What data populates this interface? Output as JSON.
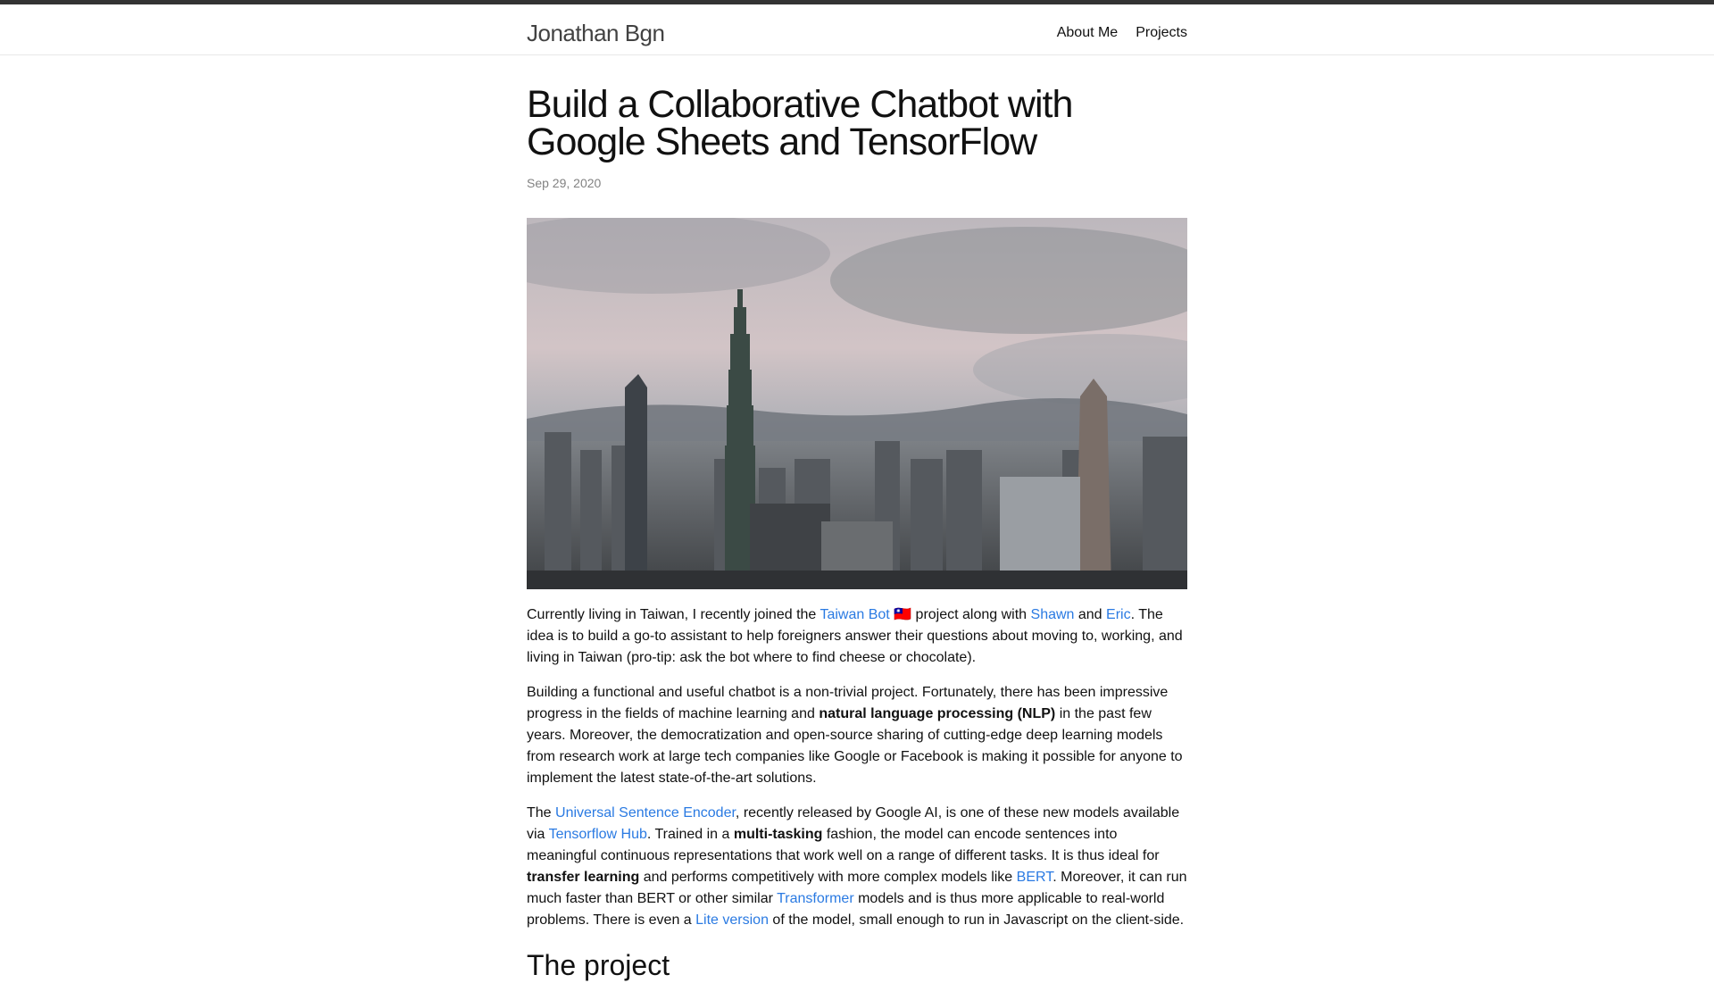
{
  "site": {
    "title": "Jonathan Bgn",
    "nav": [
      "About Me",
      "Projects"
    ]
  },
  "post": {
    "title": "Build a Collaborative Chatbot with Google Sheets and TensorFlow",
    "date": "Sep 29, 2020",
    "hero_alt": "Taipei skyline with Taipei 101",
    "p1": {
      "t1": "Currently living in Taiwan, I recently joined the ",
      "link1": "Taiwan Bot 🇹🇼",
      "t2": " project along with ",
      "link2": "Shawn",
      "t3": " and ",
      "link3": "Eric",
      "t4": ". The idea is to build a go-to assistant to help foreigners answer their questions about moving to, working, and living in Taiwan (pro-tip: ask the bot where to find cheese or chocolate)."
    },
    "p2": {
      "t1": "Building a functional and useful chatbot is a non-trivial project. Fortunately, there has been impressive progress in the fields of machine learning and ",
      "b1": "natural language processing (NLP)",
      "t2": " in the past few years. Moreover, the democratization and open-source sharing of cutting-edge deep learning models from research work at large tech companies like Google or Facebook is making it possible for anyone to implement the latest state-of-the-art solutions."
    },
    "p3": {
      "t1": "The ",
      "link1": "Universal Sentence Encoder",
      "t2": ", recently released by Google AI, is one of these new models available via ",
      "link2": "Tensorflow Hub",
      "t3": ". Trained in a ",
      "b1": "multi-tasking",
      "t4": " fashion, the model can encode sentences into meaningful continuous representations that work well on a range of different tasks. It is thus ideal for ",
      "b2": "transfer learning",
      "t5": " and performs competitively with more complex models like ",
      "link3": "BERT",
      "t6": ". Moreover, it can run much faster than BERT or other similar ",
      "link4": "Transformer",
      "t7": " models and is thus more applicable to real-world problems. There is even a ",
      "link5": "Lite version",
      "t8": " of the model, small enough to run in Javascript on the client-side."
    },
    "section_heading": "The project"
  },
  "colors": {
    "link": "#2a7ae2",
    "text": "#111111",
    "date": "#828282",
    "topbar": "#333333"
  }
}
